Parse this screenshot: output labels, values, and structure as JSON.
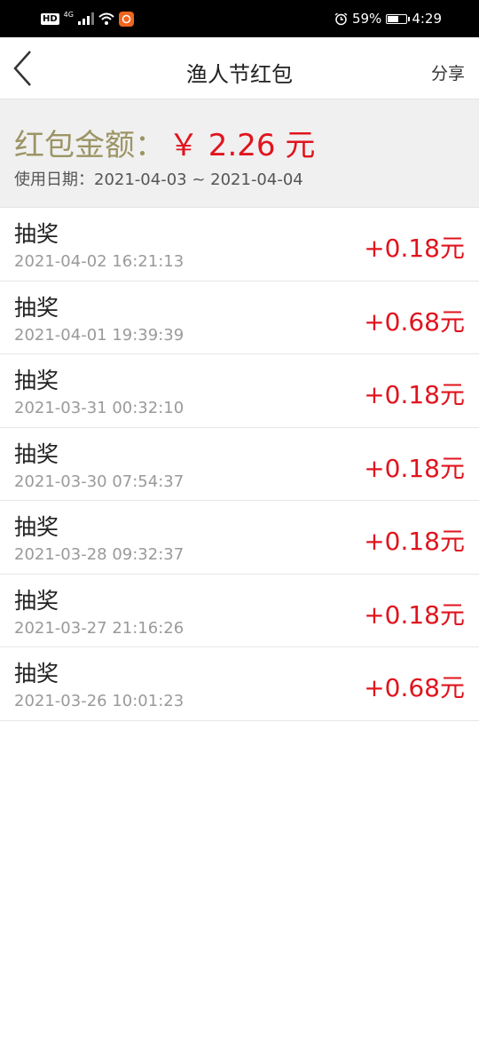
{
  "status_bar": {
    "hd": "HD",
    "network": "4G",
    "battery_percent": "59%",
    "battery_level": 0.59,
    "time": "4:29"
  },
  "nav": {
    "title": "渔人节红包",
    "share_label": "分享"
  },
  "summary": {
    "amount_label": "红包金额：",
    "amount_value": "￥ 2.26 元",
    "date_label": "使用日期：",
    "date_range": "2021-04-03 ~ 2021-04-04"
  },
  "records": [
    {
      "title": "抽奖",
      "time": "2021-04-02 16:21:13",
      "amount": "+0.18元"
    },
    {
      "title": "抽奖",
      "time": "2021-04-01 19:39:39",
      "amount": "+0.68元"
    },
    {
      "title": "抽奖",
      "time": "2021-03-31 00:32:10",
      "amount": "+0.18元"
    },
    {
      "title": "抽奖",
      "time": "2021-03-30 07:54:37",
      "amount": "+0.18元"
    },
    {
      "title": "抽奖",
      "time": "2021-03-28 09:32:37",
      "amount": "+0.18元"
    },
    {
      "title": "抽奖",
      "time": "2021-03-27 21:16:26",
      "amount": "+0.18元"
    },
    {
      "title": "抽奖",
      "time": "2021-03-26 10:01:23",
      "amount": "+0.68元"
    }
  ],
  "colors": {
    "accent_red": "#e0141e",
    "label_gold": "#9c9565",
    "summary_bg": "#f0f0f0"
  },
  "icons": [
    "back-arrow-icon",
    "signal-icon",
    "wifi-icon",
    "app-notification-icon",
    "alarm-icon",
    "battery-icon"
  ]
}
